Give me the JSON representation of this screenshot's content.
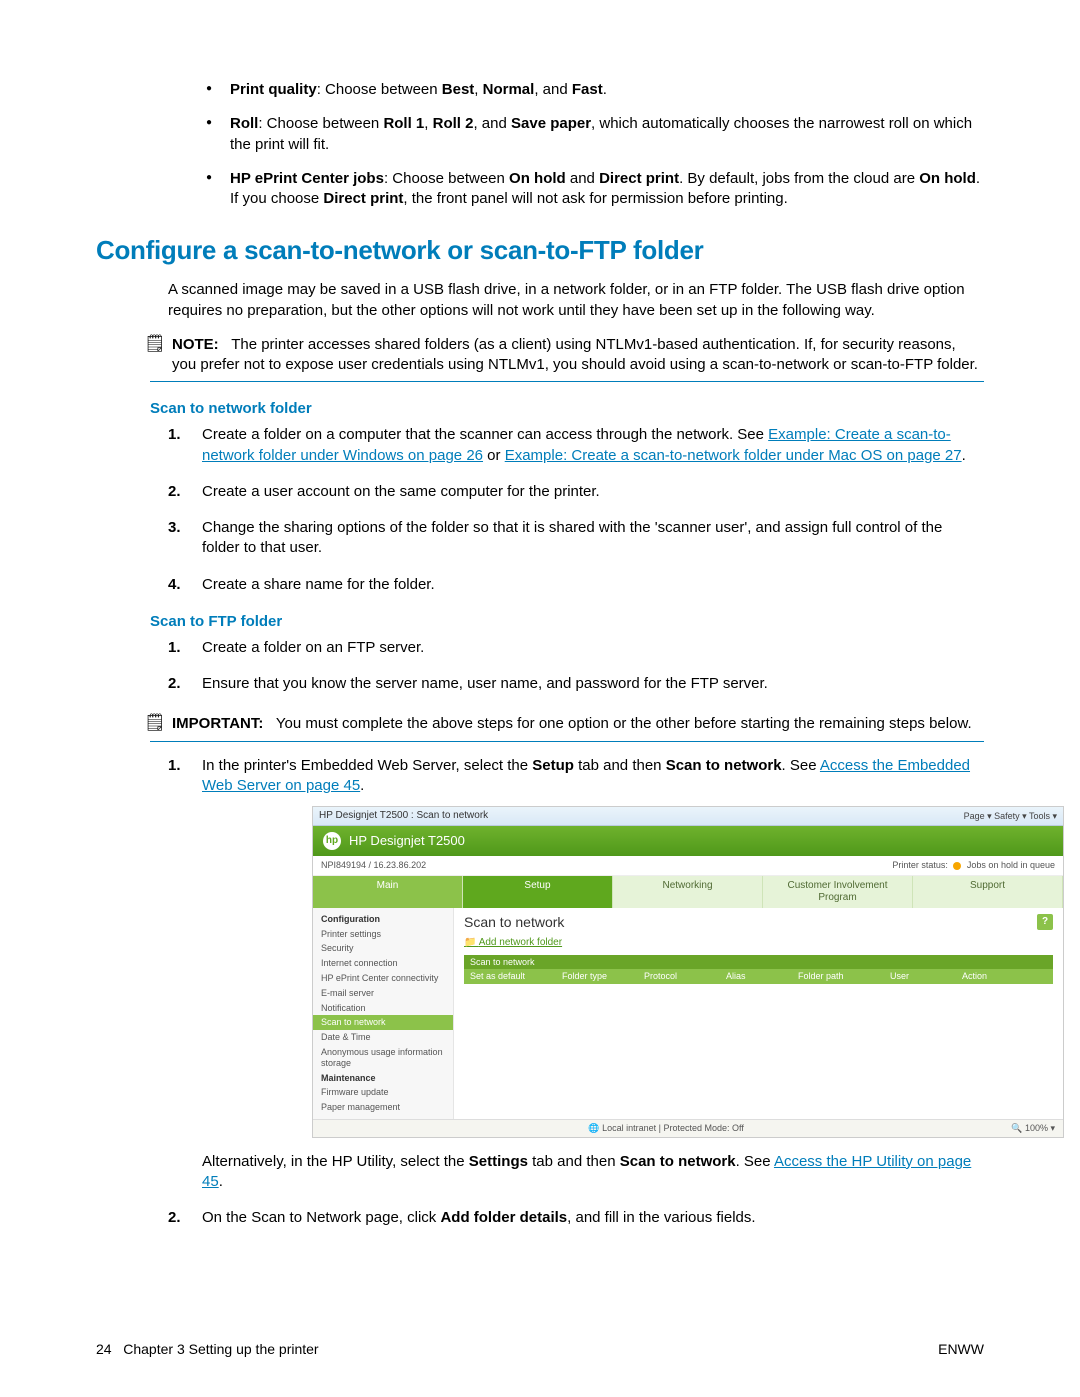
{
  "bullets": {
    "b1_pre": "Print quality",
    "b1_mid1": ": Choose between ",
    "b1_bold1": "Best",
    "b1_sep1": ", ",
    "b1_bold2": "Normal",
    "b1_sep2": ", and ",
    "b1_bold3": "Fast",
    "b1_end": ".",
    "b2_pre": "Roll",
    "b2_mid1": ": Choose between ",
    "b2_bold1": "Roll 1",
    "b2_sep1": ", ",
    "b2_bold2": "Roll 2",
    "b2_sep2": ", and ",
    "b2_bold3": "Save paper",
    "b2_end": ", which automatically chooses the narrowest roll on which the print will fit.",
    "b3_pre": "HP ePrint Center jobs",
    "b3_mid1": ": Choose between ",
    "b3_bold1": "On hold",
    "b3_sep1": " and ",
    "b3_bold2": "Direct print",
    "b3_mid2": ". By default, jobs from the cloud are ",
    "b3_bold3": "On hold",
    "b3_mid3": ". If you choose ",
    "b3_bold4": "Direct print",
    "b3_end": ", the front panel will not ask for permission before printing."
  },
  "h2": "Configure a scan-to-network or scan-to-FTP folder",
  "intro": "A scanned image may be saved in a USB flash drive, in a network folder, or in an FTP folder. The USB flash drive option requires no preparation, but the other options will not work until they have been set up in the following way.",
  "note": {
    "label": "NOTE:",
    "text": "The printer accesses shared folders (as a client) using NTLMv1-based authentication. If, for security reasons, you prefer not to expose user credentials using NTLMv1, you should avoid using a scan-to-network or scan-to-FTP folder."
  },
  "scan_net_title": "Scan to network folder",
  "scan_net_steps": {
    "s1a": "Create a folder on a computer that the scanner can access through the network. See ",
    "s1link1": "Example: Create a scan-to-network folder under Windows on page 26",
    "s1b": " or ",
    "s1link2": "Example: Create a scan-to-network folder under Mac OS on page 27",
    "s1c": ".",
    "s2": "Create a user account on the same computer for the printer.",
    "s3": "Change the sharing options of the folder so that it is shared with the 'scanner user', and assign full control of the folder to that user.",
    "s4": "Create a share name for the folder."
  },
  "scan_ftp_title": "Scan to FTP folder",
  "scan_ftp_steps": {
    "s1": "Create a folder on an FTP server.",
    "s2": "Ensure that you know the server name, user name, and password for the FTP server."
  },
  "important": {
    "label": "IMPORTANT:",
    "text": "You must complete the above steps for one option or the other before starting the remaining steps below."
  },
  "final_steps": {
    "s1a": "In the printer's Embedded Web Server, select the ",
    "s1b1": "Setup",
    "s1b": " tab and then ",
    "s1b2": "Scan to network",
    "s1c": ". See ",
    "s1link": "Access the Embedded Web Server on page 45",
    "s1d": ".",
    "alt_a": "Alternatively, in the HP Utility, select the ",
    "alt_b1": "Settings",
    "alt_b": " tab and then ",
    "alt_b2": "Scan to network",
    "alt_c": ". See ",
    "alt_link": "Access the HP Utility on page 45",
    "alt_d": ".",
    "s2a": "On the Scan to Network page, click ",
    "s2b": "Add folder details",
    "s2c": ", and fill in the various fields."
  },
  "screenshot": {
    "window_title": "HP Designjet T2500 : Scan to network",
    "toolbar_items": "Page ▾    Safety ▾    Tools ▾",
    "product": "HP Designjet T2500",
    "ip": "NPI849194 / 16.23.86.202",
    "status_label": "Printer status:",
    "status_value": "Jobs on hold in queue",
    "tabs": [
      "Main",
      "Setup",
      "Networking",
      "Customer Involvement Program",
      "Support"
    ],
    "side": {
      "h1": "Configuration",
      "i1": "Printer settings",
      "i2": "Security",
      "i3": "Internet connection",
      "i4": "HP ePrint Center connectivity",
      "i5": "E-mail server",
      "i6": "Notification",
      "i7": "Scan to network",
      "i8": "Date & Time",
      "i9": "Anonymous usage information storage",
      "h2": "Maintenance",
      "i10": "Firmware update",
      "i11": "Paper management"
    },
    "main_title": "Scan to network",
    "add_link": "Add network folder",
    "table": {
      "r1": "Scan to network",
      "c1": "Set as default",
      "c2": "Folder type",
      "c3": "Protocol",
      "c4": "Alias",
      "c5": "Folder path",
      "c6": "User",
      "c7": "Action"
    },
    "bottom_left": "",
    "bottom_center": "Local intranet | Protected Mode: Off",
    "bottom_right": "100%  ▾"
  },
  "footer": {
    "page": "24",
    "chapter": "Chapter 3   Setting up the printer",
    "right": "ENWW"
  }
}
